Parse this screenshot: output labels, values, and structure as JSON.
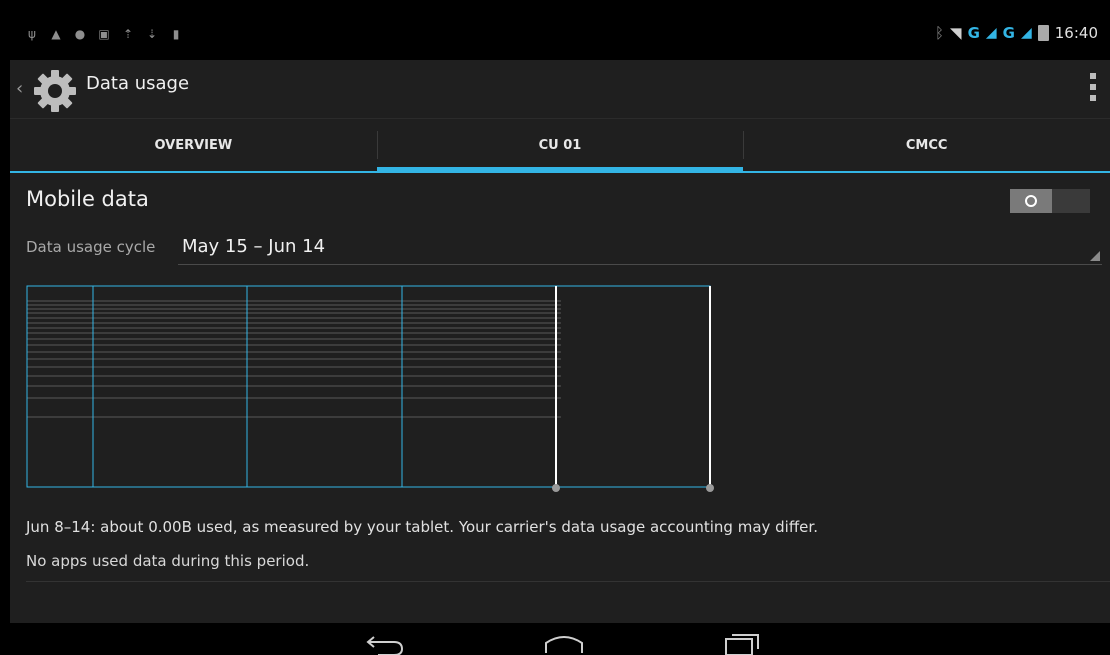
{
  "status": {
    "left_icons": [
      "usb-icon",
      "lock-icon",
      "sync-icon",
      "image-icon",
      "upload-icon",
      "download-icon",
      "sd-card-icon"
    ],
    "g1": "G",
    "g2": "G",
    "time": "16:40"
  },
  "actionbar": {
    "title": "Data usage",
    "icon": "settings-gear-icon"
  },
  "tabs": [
    {
      "label": "OVERVIEW",
      "active": false
    },
    {
      "label": "CU 01",
      "active": true
    },
    {
      "label": "CMCC",
      "active": false
    }
  ],
  "mobile_data": {
    "label": "Mobile data",
    "toggle_on": false
  },
  "cycle": {
    "label": "Data usage cycle",
    "value": "May 15 – Jun 14"
  },
  "summary": {
    "text": "Jun 8–14: about 0.00B used, as measured by your tablet. Your carrier's data usage accounting may differ.",
    "no_apps": "No apps used data during this period."
  },
  "colors": {
    "accent": "#33b5e5",
    "background": "#1f1f1f"
  }
}
